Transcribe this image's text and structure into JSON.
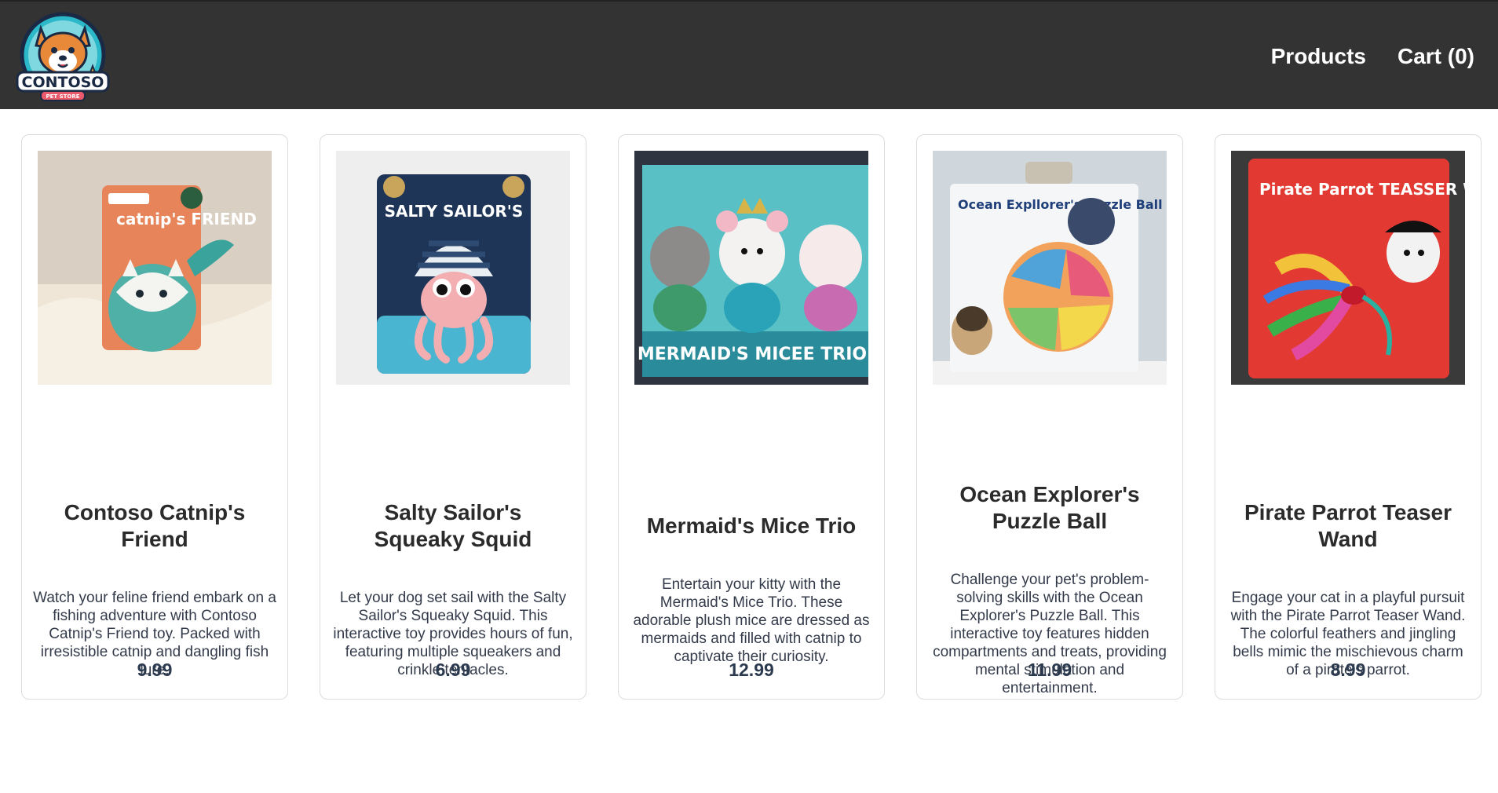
{
  "header": {
    "logo_text": "CONTOSO",
    "logo_subtext": "PET STORE",
    "nav": {
      "products": "Products",
      "cart": "Cart (0)"
    }
  },
  "products": [
    {
      "title": "Contoso Catnip's Friend",
      "description": "Watch your feline friend embark on a fishing adventure with Contoso Catnip's Friend toy. Packed with irresistible catnip and dangling fish lure.",
      "price": "9.99",
      "image_label": "catnip's FRIEND"
    },
    {
      "title": "Salty Sailor's Squeaky Squid",
      "description": "Let your dog set sail with the Salty Sailor's Squeaky Squid. This interactive toy provides hours of fun, featuring multiple squeakers and crinkle tentacles.",
      "price": "6.99",
      "image_label": "SALTY SAILOR'S"
    },
    {
      "title": "Mermaid's Mice Trio",
      "description": "Entertain your kitty with the Mermaid's Mice Trio. These adorable plush mice are dressed as mermaids and filled with catnip to captivate their curiosity.",
      "price": "12.99",
      "image_label": "MERMAID'S MICEE TRIO"
    },
    {
      "title": "Ocean Explorer's Puzzle Ball",
      "description": "Challenge your pet's problem-solving skills with the Ocean Explorer's Puzzle Ball. This interactive toy features hidden compartments and treats, providing mental stimulation and entertainment.",
      "price": "11.99",
      "image_label": "Ocean Expllorer's Puzzle Ball"
    },
    {
      "title": "Pirate Parrot Teaser Wand",
      "description": "Engage your cat in a playful pursuit with the Pirate Parrot Teaser Wand. The colorful feathers and jingling bells mimic the mischievous charm of a pirate's parrot.",
      "price": "8.99",
      "image_label": "Pirate Parrot TEASSER WAND"
    }
  ]
}
